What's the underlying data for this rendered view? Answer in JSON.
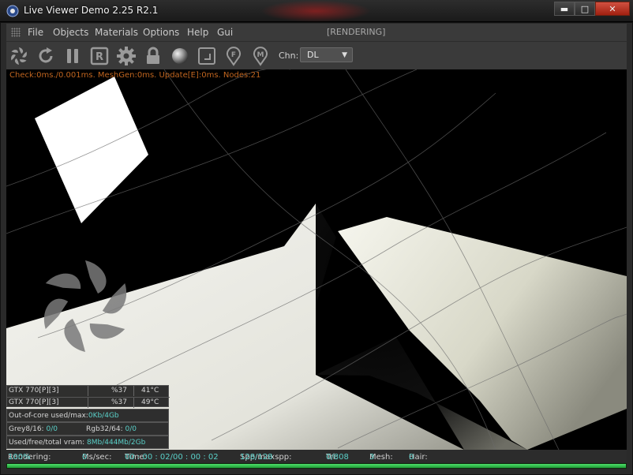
{
  "window": {
    "title": "Live Viewer Demo 2.25 R2.1",
    "buttons": {
      "minimize": "▬",
      "maximize": "□",
      "close": "✕"
    }
  },
  "menu": {
    "items": [
      "File",
      "Objects",
      "Materials",
      "Options",
      "Help",
      "Gui"
    ],
    "status": "[RENDERING]"
  },
  "toolbar": {
    "icons": [
      "octane-logo-icon",
      "refresh-icon",
      "pause-icon",
      "r-region-icon",
      "settings-gear-icon",
      "lock-icon",
      "material-sphere-icon",
      "resize-frame-icon",
      "f-pin-icon",
      "m-pin-icon"
    ],
    "r_letter": "R",
    "f_letter": "F",
    "m_letter": "M",
    "channel_label": "Chn:",
    "channel_value": "DL"
  },
  "viewport": {
    "stats": "Check:0ms./0.001ms. MeshGen:0ms. Update[E]:0ms. Nodes:21"
  },
  "gpus": [
    {
      "name": "GTX 770[P][3]",
      "usage": "%37",
      "temp": "41°C"
    },
    {
      "name": "GTX 770[P][3]",
      "usage": "%37",
      "temp": "49°C"
    }
  ],
  "memory": {
    "outofcore_label": "Out-of-core used/max:",
    "outofcore_value": "0Kb/4Gb",
    "grey_label": "Grey8/16:",
    "grey_value": "0/0",
    "rgb_label": "Rgb32/64:",
    "rgb_value": "0/0",
    "vram_label": "Used/free/total vram:",
    "vram_value": "8Mb/444Mb/2Gb"
  },
  "status": {
    "rendering_label": "Rendering:",
    "rendering_value": "100%",
    "mssec_label": "Ms/sec:",
    "mssec_value": "0",
    "time_label": "Time:",
    "time_value": "00 : 00 : 02/00 : 00 : 02",
    "spp_label": "Spp/maxspp:",
    "spp_value": "128/128",
    "tri_label": "Tri:",
    "tri_value": "0/808",
    "mesh_label": "Mesh:",
    "mesh_value": "3",
    "hair_label": "Hair:",
    "hair_value": "0",
    "progress": 1.0
  },
  "colors": {
    "stats_text": "#c0651f",
    "highlight_value": "#5ad0c8",
    "progress": "#3ccf5a"
  }
}
